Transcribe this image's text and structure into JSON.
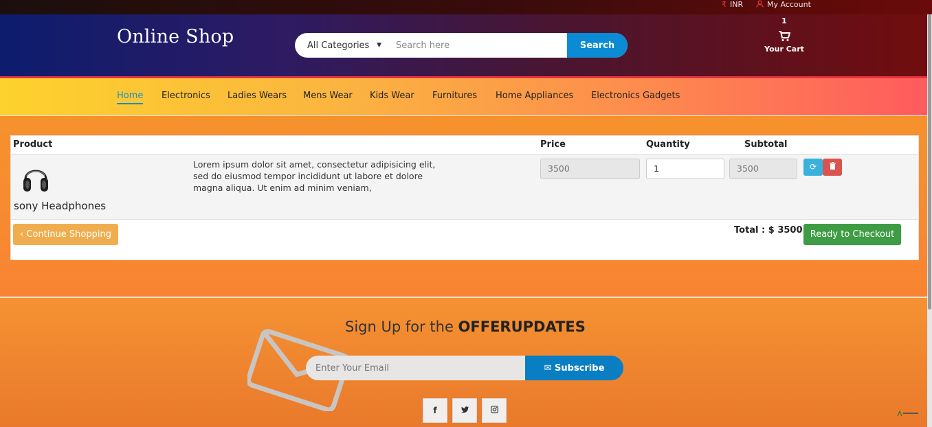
{
  "topbar": {
    "currency_icon": "rupee-icon",
    "currency_label": "INR",
    "account_icon": "user-icon",
    "account_label": "My Account"
  },
  "header": {
    "logo": "Online Shop",
    "category_selected": "All Categories",
    "search_placeholder": "Search here",
    "search_button": "Search",
    "cart_label": "Your Cart",
    "cart_count": "1"
  },
  "nav": {
    "items": [
      "Home",
      "Electronics",
      "Ladies Wears",
      "Mens Wear",
      "Kids Wear",
      "Furnitures",
      "Home Appliances",
      "Electronics Gadgets"
    ],
    "active": "Home"
  },
  "cart": {
    "headers": {
      "product": "Product",
      "price": "Price",
      "quantity": "Quantity",
      "subtotal": "Subtotal"
    },
    "items": [
      {
        "name": "sony Headphones",
        "description": "Lorem ipsum dolor sit amet, consectetur adipisicing elit, sed do eiusmod tempor incididunt ut labore et dolore magna aliqua. Ut enim ad minim veniam,",
        "price": "3500",
        "quantity": "1",
        "subtotal": "3500"
      }
    ],
    "continue_label": "Continue Shopping",
    "total_label": "Total : $ 3500",
    "checkout_label": "Ready to Checkout"
  },
  "footer": {
    "signup_prefix": "Sign Up for the ",
    "signup_bold": "OFFERUPDATES",
    "email_placeholder": "Enter Your Email",
    "subscribe_label": "Subscribe",
    "social": [
      "f",
      "t",
      "ig"
    ]
  },
  "colors": {
    "accent_blue": "#0a8bd4",
    "checkout_green": "#3e9c45",
    "continue_orange": "#f0ad4e",
    "badge_red": "#d8102b"
  }
}
